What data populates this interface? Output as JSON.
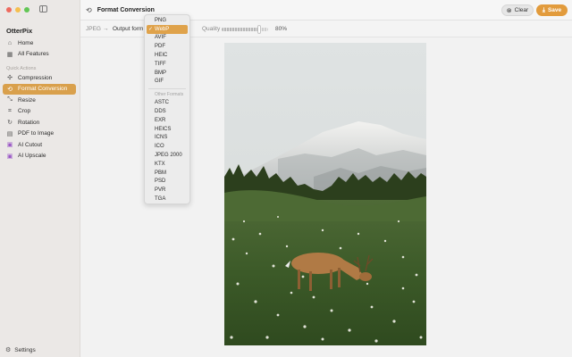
{
  "app": {
    "name": "OtterPix"
  },
  "sidebar": {
    "main_items": [
      {
        "label": "Home",
        "icon": "home-icon"
      },
      {
        "label": "All Features",
        "icon": "grid-icon"
      }
    ],
    "section_label": "Quick Actions",
    "quick_items": [
      {
        "label": "Compression",
        "icon": "compress-icon"
      },
      {
        "label": "Format Conversion",
        "icon": "convert-icon",
        "active": true
      },
      {
        "label": "Resize",
        "icon": "resize-icon"
      },
      {
        "label": "Crop",
        "icon": "crop-icon"
      },
      {
        "label": "Rotation",
        "icon": "rotate-icon"
      },
      {
        "label": "PDF to Image",
        "icon": "document-icon"
      },
      {
        "label": "AI Cutout",
        "icon": "ai-cutout-icon"
      },
      {
        "label": "AI Upscale",
        "icon": "ai-upscale-icon"
      }
    ],
    "settings_label": "Settings"
  },
  "titlebar": {
    "title": "Format Conversion",
    "clear_label": "Clear",
    "save_label": "Save"
  },
  "toolbar": {
    "source_format": "JPEG",
    "arrow": "→",
    "output_label": "Output form",
    "quality_label": "Quality",
    "quality_value": "80%",
    "quality_fraction": 0.8
  },
  "dropdown": {
    "primary": [
      "PNG",
      "WebP",
      "AVIF",
      "PDF",
      "HEIC",
      "TIFF",
      "BMP",
      "GIF"
    ],
    "selected": "WebP",
    "other_header": "Other Formats",
    "other": [
      "ASTC",
      "DDS",
      "EXR",
      "HEICS",
      "ICNS",
      "ICO",
      "JPEG 2000",
      "KTX",
      "PBM",
      "PSD",
      "PVR",
      "TGA"
    ]
  },
  "colors": {
    "accent": "#d9a04c",
    "save": "#e29b3c"
  }
}
